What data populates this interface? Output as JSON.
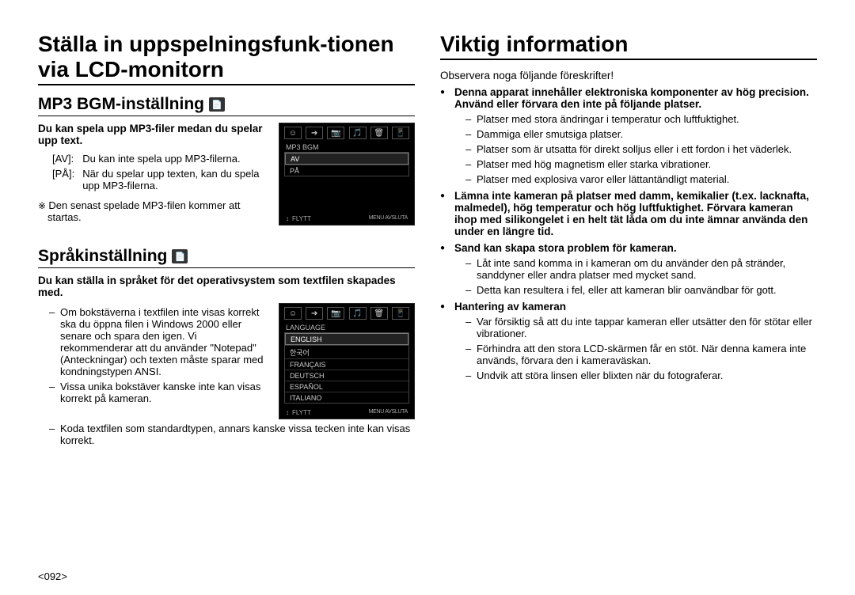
{
  "left": {
    "h1": "Ställa in uppspelningsfunk-tionen via LCD-monitorn",
    "mp3": {
      "heading": "MP3 BGM-inställning",
      "lead": "Du kan spela upp MP3-filer medan du spelar upp text.",
      "table": [
        {
          "k": "[AV]:",
          "v": "Du kan inte spela upp MP3-filerna."
        },
        {
          "k": "[PÅ]:",
          "v": "När du spelar upp texten, kan du spela upp MP3-filerna."
        }
      ],
      "note": "Den senast spelade MP3-filen kommer att startas.",
      "screen": {
        "tabs": [
          "☺",
          "➔",
          "📷",
          "🎵",
          "🗑",
          "📱"
        ],
        "title": "MP3 BGM",
        "items": [
          "AV",
          "PÅ"
        ],
        "footer_left": "FLYTT",
        "footer_right": "MENU AVSLUTA"
      }
    },
    "lang": {
      "heading": "Språkinställning",
      "lead": "Du kan ställa in språket för det operativsystem som textfilen skapades med.",
      "dashes": [
        "Om bokstäverna i textfilen inte visas korrekt ska du öppna filen i Windows 2000 eller senare och spara den igen. Vi rekommenderar att du använder \"Notepad\" (Anteckningar) och texten måste sparar med kondningstypen ANSI.",
        "Vissa unika bokstäver kanske inte kan visas korrekt på kameran.",
        "Koda textfilen som standardtypen, annars kanske vissa tecken inte kan visas korrekt."
      ],
      "screen": {
        "tabs": [
          "☺",
          "➔",
          "📷",
          "🎵",
          "🗑",
          "📱"
        ],
        "title": "LANGUAGE",
        "items": [
          "ENGLISH",
          "한국어",
          "FRANÇAIS",
          "DEUTSCH",
          "ESPAÑOL",
          "ITALIANO"
        ],
        "footer_left": "FLYTT",
        "footer_right": "MENU AVSLUTA"
      }
    }
  },
  "right": {
    "h1": "Viktig information",
    "intro": "Observera noga följande föreskrifter!",
    "bullets": [
      {
        "head": "Denna apparat innehåller elektroniska komponenter av hög precision. Använd eller förvara den inte på följande platser.",
        "sub": [
          "Platser med stora ändringar i temperatur och luftfuktighet.",
          "Dammiga eller smutsiga platser.",
          "Platser som är utsatta för direkt solljus eller i ett fordon i het väderlek.",
          "Platser med hög magnetism eller starka vibrationer.",
          "Platser med explosiva varor eller lättantändligt material."
        ]
      },
      {
        "head": "Lämna inte kameran på platser med damm, kemikalier (t.ex. lacknafta, malmedel), hög temperatur och hög luftfuktighet. Förvara kameran ihop med silikongelet i en helt tät låda om du inte ämnar använda den under en längre tid.",
        "sub": []
      },
      {
        "head": "Sand kan skapa stora problem för kameran.",
        "sub": [
          "Låt inte sand komma in i kameran om du använder den på stränder, sanddyner eller andra platser med mycket sand.",
          "Detta kan resultera i fel, eller att kameran blir oanvändbar för gott."
        ]
      },
      {
        "head": "Hantering av kameran",
        "sub": [
          "Var försiktig så att du inte tappar kameran eller utsätter den för stötar eller vibrationer.",
          "Förhindra att den stora LCD-skärmen får en stöt. När denna kamera inte används, förvara den i kameraväskan.",
          "Undvik att störa linsen eller blixten när du fotograferar."
        ]
      }
    ]
  },
  "page_num": "<092>"
}
